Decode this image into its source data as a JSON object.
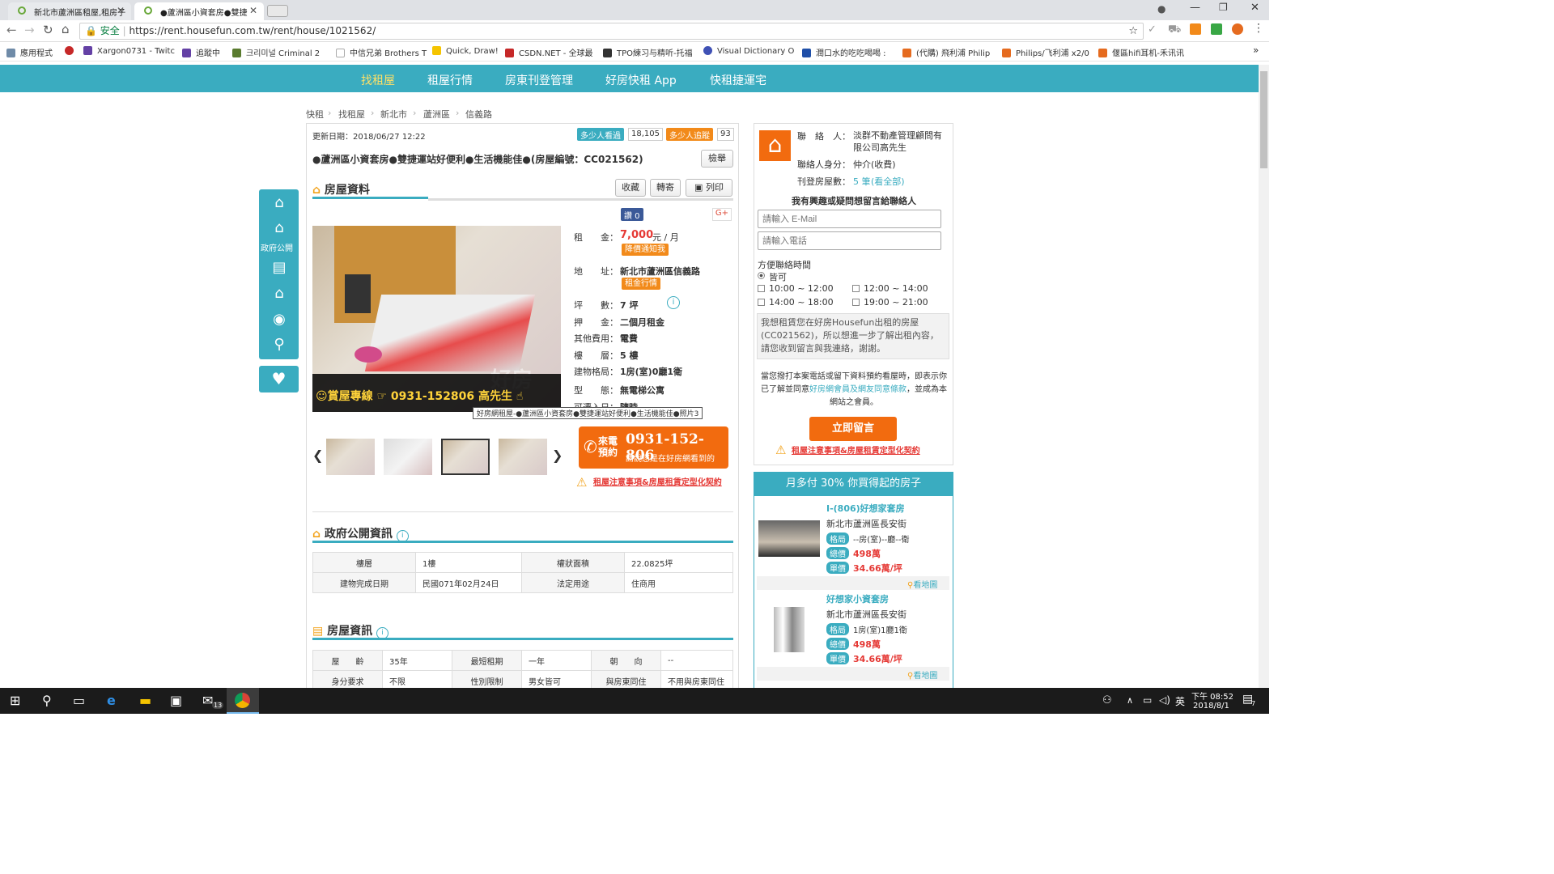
{
  "browser": {
    "tabs": [
      {
        "title": "新北市蘆洲區租屋,租房子"
      },
      {
        "title": "●蘆洲區小資套房●雙捷"
      }
    ],
    "security": "安全",
    "url": "https://rent.housefun.com.tw/rent/house/1021562/"
  },
  "bookmarks": [
    "應用程式",
    "Xargon0731 - Twitc",
    "追蹤中",
    "크리미널 Criminal 2",
    "中信兄弟 Brothers T",
    "Quick, Draw!",
    "CSDN.NET - 全球最",
    "TPO練习与精听-托福",
    "Visual Dictionary O",
    "潤口水的吃吃喝喝 :",
    "(代購) 飛利浦 Philip",
    "Philips/飞利浦 x2/0",
    "偃區hifi耳机-禾讯讯"
  ],
  "site_nav": [
    "找租屋",
    "租屋行情",
    "房東刊登管理",
    "好房快租 App",
    "快租捷運宅"
  ],
  "breadcrumb": [
    "快租",
    "找租屋",
    "新北市",
    "蘆洲區",
    "信義路"
  ],
  "listing": {
    "updated": "更新日期：2018/06/27 12:22",
    "viewers_label": "多少人看過",
    "viewers": "18,105",
    "trackers_label": "多少人追蹤",
    "trackers": "93",
    "title": "●蘆洲區小資套房●雙捷運站好便利●生活機能佳●(房屋編號：CC021562)",
    "report": "檢舉",
    "section": "房屋資料",
    "actions": [
      "收藏",
      "轉寄",
      "列印"
    ],
    "like": "讚 0",
    "photo_caption": "好房網租屋-●蘆洲區小資套房●雙捷運站好便利●生活機能佳●照片3",
    "photo_phone": "☺賞屋專線 ☞ 0931-152806 高先生 ☝",
    "photo_wm": "好房",
    "rent_label": "租　　金：",
    "rent": "7,000",
    "rent_unit": "元 / 月",
    "price_alert": "降價通知我",
    "addr_label": "地　　址：",
    "addr": "新北市蘆洲區信義路",
    "market": "租金行情",
    "size_label": "坪　　數：",
    "size": "7 坪",
    "deposit_label": "押　　金：",
    "deposit": "二個月租金",
    "fee_label": "其他費用：",
    "fee": "電費",
    "floor_label": "樓　　層：",
    "floor": "5 樓",
    "layout_label": "建物格局：",
    "layout": "1房(室)0廳1衛",
    "type_label": "型　　態：",
    "type": "無電梯公寓",
    "movein_label": "可遷入日：",
    "movein": "隨時",
    "call_label": "來電預約",
    "phone": "0931-152-806",
    "call_note": "請說您是在好房網看到的",
    "notice": "租屋注意事項&房屋租賃定型化契約"
  },
  "gov": {
    "title": "政府公開資訊",
    "rows": [
      [
        "樓層",
        "1樓",
        "權狀面積",
        "22.0825坪"
      ],
      [
        "建物完成日期",
        "民國071年02月24日",
        "法定用途",
        "住商用"
      ]
    ]
  },
  "info": {
    "title": "房屋資訊",
    "rows": [
      [
        "屋　　齡",
        "35年",
        "最短租期",
        "一年",
        "朝　　向",
        "--"
      ],
      [
        "身分要求",
        "不限",
        "性別限制",
        "男女皆可",
        "與房東同住",
        "不用與房東同住"
      ]
    ]
  },
  "contact": {
    "name_label": "聯　絡　人：",
    "name": "淡群不動產管理顧問有限公司高先生",
    "role_label": "聯絡人身分：",
    "role": "仲介(收費)",
    "count_label": "刊登房屋數：",
    "count": "5 筆",
    "view_all": "(看全部)",
    "prompt": "我有興趣或疑問想留言給聯絡人",
    "email_ph": "請輸入 E-Mail",
    "phone_ph": "請輸入電話",
    "time_label": "方便聯絡時間",
    "times": [
      "皆可",
      "10:00 ~ 12:00",
      "12:00 ~ 14:00",
      "14:00 ~ 18:00",
      "19:00 ~ 21:00"
    ],
    "message": "我想租賃您在好房Housefun出租的房屋(CC021562)，所以想進一步了解出租內容，請您收到留言與我連絡，謝謝。",
    "terms_a": "當您撥打本案電話或留下資料預約看屋時，即表示你已了解並同意",
    "terms_link": "好房網會員及網友同意條款",
    "terms_b": "，並成為本網站之會員。",
    "submit": "立即留言",
    "notice": "租屋注意事項&房屋租賃定型化契約"
  },
  "promo": {
    "header": "月多付 30% 你買得起的房子",
    "items": [
      {
        "title": "I-(806)好想家套房",
        "addr": "新北市蘆洲區長安街",
        "layout_tag": "格局",
        "layout": "--房(室)--廳--衛",
        "total_tag": "總價",
        "total": "498萬",
        "unit_tag": "單價",
        "unit": "34.66萬/坪",
        "map": "看地圖"
      },
      {
        "title": "好想家小資套房",
        "addr": "新北市蘆洲區長安街",
        "layout_tag": "格局",
        "layout": "1房(室)1廳1衛",
        "total_tag": "總價",
        "total": "498萬",
        "unit_tag": "單價",
        "unit": "34.66萬/坪",
        "map": "看地圖"
      }
    ]
  },
  "left_sidebar": {
    "gov_label": "政府公開"
  },
  "taskbar": {
    "time": "下午 08:52",
    "date": "2018/8/1",
    "mail_badge": "13",
    "notif": "7"
  }
}
